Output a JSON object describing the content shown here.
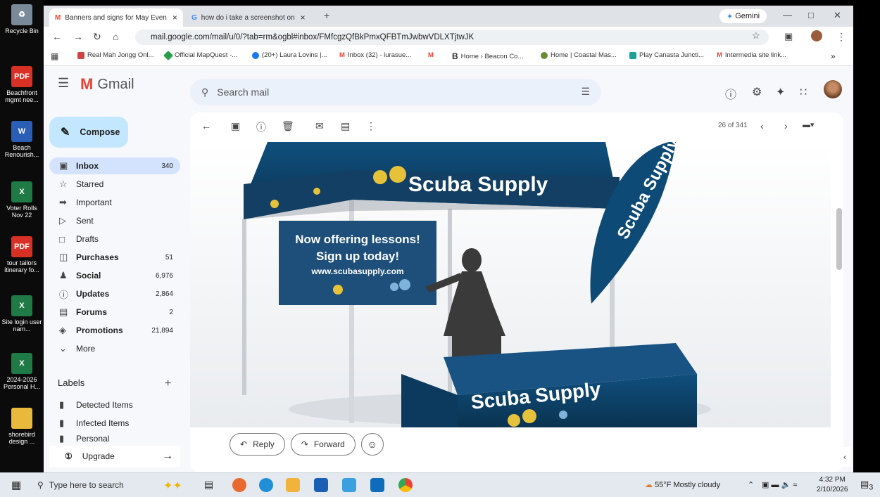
{
  "desktop": {
    "icons": [
      {
        "label": "Recycle Bin",
        "icon": "recycle-bin-icon",
        "badge": ""
      },
      {
        "label": "Beachfront mgmt nee...",
        "icon": "pdf-file-icon",
        "badge": "PDF"
      },
      {
        "label": "Beach Renourish...",
        "icon": "word-file-icon",
        "badge": "W"
      },
      {
        "label": "Voter Rolls Nov 22",
        "icon": "excel-file-icon",
        "badge": "X"
      },
      {
        "label": "tour tailors itinerary fo...",
        "icon": "pdf-file-icon",
        "badge": "PDF"
      },
      {
        "label": "Site login user nam...",
        "icon": "excel-file-icon",
        "badge": "X"
      },
      {
        "label": "2024-2026 Personal H...",
        "icon": "excel-file-icon",
        "badge": "X"
      },
      {
        "label": "shorebird design ...",
        "icon": "folder-icon",
        "badge": ""
      }
    ]
  },
  "browser": {
    "tabs": [
      {
        "label": "Banners and signs for May Even",
        "favicon": "gmail-icon"
      },
      {
        "label": "how do i take a screenshot on",
        "favicon": "google-icon"
      }
    ],
    "gemini_label": "Gemini",
    "url": "mail.google.com/mail/u/0/?tab=rm&ogbl#inbox/FMfcgzQfBkPmxQFBTmJwbwVDLXTjtwJK",
    "bookmarks": [
      "Real Mah Jongg Onl...",
      "Official MapQuest -...",
      "(20+) Laura Lovins |...",
      "Inbox (32) - lurasue...",
      "",
      "Home › Beacon Co...",
      "Home | Coastal Mas...",
      "Play Canasta Juncti...",
      "Intermedia site link..."
    ],
    "bookmarks_more": "»"
  },
  "gmail": {
    "product_name": "Gmail",
    "search_placeholder": "Search mail",
    "compose_label": "Compose",
    "nav": [
      {
        "label": "Inbox",
        "count": "340",
        "icon": "inbox-icon"
      },
      {
        "label": "Starred",
        "count": "",
        "icon": "star-icon"
      },
      {
        "label": "Important",
        "count": "",
        "icon": "important-icon"
      },
      {
        "label": "Sent",
        "count": "",
        "icon": "send-icon"
      },
      {
        "label": "Drafts",
        "count": "",
        "icon": "draft-icon"
      },
      {
        "label": "Purchases",
        "count": "51",
        "icon": "purchases-icon"
      },
      {
        "label": "Social",
        "count": "6,976",
        "icon": "social-icon"
      },
      {
        "label": "Updates",
        "count": "2,864",
        "icon": "updates-icon"
      },
      {
        "label": "Forums",
        "count": "2",
        "icon": "forums-icon"
      },
      {
        "label": "Promotions",
        "count": "21,894",
        "icon": "promotions-icon"
      },
      {
        "label": "More",
        "count": "",
        "icon": "chevron-down-icon"
      }
    ],
    "labels_heading": "Labels",
    "labels": [
      "Detected Items",
      "Infected Items",
      "Personal"
    ],
    "upgrade_label": "Upgrade",
    "pagination": "26 of 341",
    "reply_label": "Reply",
    "forward_label": "Forward"
  },
  "image": {
    "canopy_text": "Scuba Supply",
    "flag_text": "Scuba Supply",
    "banner_line1": "Now offering lessons!",
    "banner_line2": "Sign up today!",
    "banner_url": "www.scubasupply.com",
    "table_text": "Scuba Supply"
  },
  "taskbar": {
    "search_placeholder": "Type here to search",
    "weather": "55°F  Mostly cloudy",
    "time": "4:32 PM",
    "date": "2/10/2026",
    "notification_count": "3"
  },
  "colors": {
    "accent": "#0b57d0",
    "compose_bg": "#c2e7ff",
    "selected_nav": "#d3e3fd",
    "banner_blue": "#1d4f7a"
  }
}
